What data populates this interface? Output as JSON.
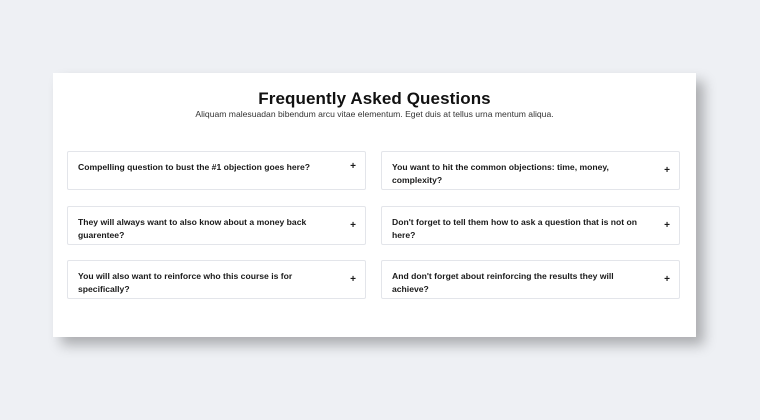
{
  "faq": {
    "title": "Frequently Asked Questions",
    "subtitle": "Aliquam malesuadan bibendum arcu vitae elementum. Eget duis at tellus urna mentum aliqua.",
    "expand_symbol": "+",
    "items": [
      {
        "question": "Compelling question to bust the #1 objection goes here?"
      },
      {
        "question": "You want to hit the common objections: time, money, complexity?"
      },
      {
        "question": "They will always want to also know about a money back guarentee?"
      },
      {
        "question": "Don't forget to tell them how to ask a question that is not on here?"
      },
      {
        "question": "You will also want to reinforce who this course is for specifically?"
      },
      {
        "question": "And don't forget about reinforcing the results they will achieve?"
      }
    ]
  }
}
